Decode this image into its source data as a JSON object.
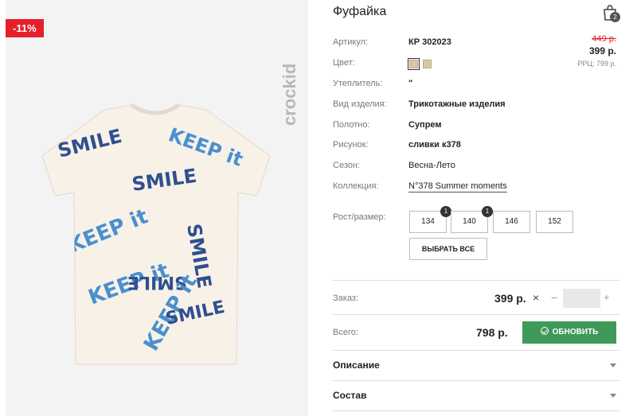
{
  "product": {
    "title": "Фуфайка",
    "discount_badge": "-11%",
    "brand_logo": "crockid",
    "cart_count": "2",
    "old_price": "449 р.",
    "new_price": "399 р.",
    "rrc_price": "РРЦ: 799 р.",
    "shirt_print": [
      "SMILE",
      "KEEP it",
      "SMILE",
      "KEEP it",
      "SMILE",
      "KEEP it",
      "SMILE",
      "KEEP it",
      "SMILE"
    ],
    "colors": {
      "accent": "#e3202c",
      "button": "#3f9a5a",
      "swatch": "#d8c7a2"
    }
  },
  "attrs": [
    {
      "label": "Артикул:",
      "value": "КР 302023"
    },
    {
      "label": "Цвет:",
      "value": ""
    },
    {
      "label": "Утеплитель:",
      "value": "\""
    },
    {
      "label": "Вид изделия:",
      "value": "Трикотажные изделия"
    },
    {
      "label": "Полотно:",
      "value": "Супрем"
    },
    {
      "label": "Рисунок:",
      "value": "сливки к378"
    },
    {
      "label": "Сезон:",
      "value": "Весна-Лето"
    },
    {
      "label": "Коллекция:",
      "value": "N°378 Summer moments"
    }
  ],
  "sizes": {
    "label": "Рост/размер:",
    "options": [
      {
        "value": "134",
        "count": "1"
      },
      {
        "value": "140",
        "count": "1"
      },
      {
        "value": "146",
        "count": ""
      },
      {
        "value": "152",
        "count": ""
      }
    ],
    "select_all": "ВЫБРАТЬ ВСЕ"
  },
  "order": {
    "label": "Заказ:",
    "price": "399 р.",
    "times": "×",
    "minus": "−",
    "plus": "+",
    "qty": ""
  },
  "total": {
    "label": "Всего:",
    "price": "798 р.",
    "update": "ОБНОВИТЬ"
  },
  "accordions": [
    {
      "title": "Описание"
    },
    {
      "title": "Состав"
    }
  ]
}
